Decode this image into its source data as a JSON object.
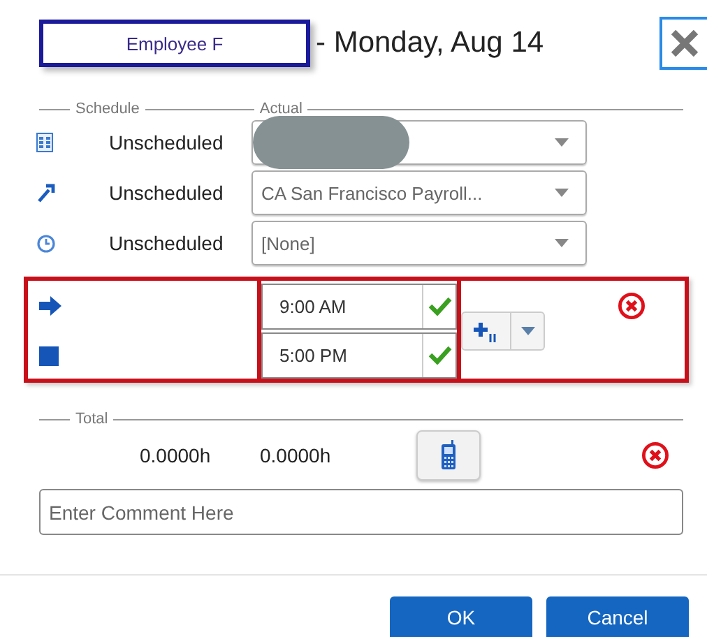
{
  "dialog": {
    "employee": "Employee F",
    "title": "- Monday, Aug 14"
  },
  "legend": {
    "schedule": "Schedule",
    "actual": "Actual"
  },
  "fields": [
    {
      "kind": "department",
      "schedule": "Unscheduled",
      "redacted": true
    },
    {
      "kind": "job",
      "schedule": "Unscheduled",
      "value": "CA San Francisco Payroll...",
      "redacted": false
    },
    {
      "kind": "clock",
      "schedule": "Unscheduled",
      "value": "[None]",
      "redacted": false
    }
  ],
  "punches": [
    {
      "kind": "in",
      "time": "9:00 AM",
      "valid": true
    },
    {
      "kind": "out",
      "time": "5:00 PM",
      "valid": true
    }
  ],
  "total": {
    "label": "Total",
    "schedule": "0.0000h",
    "actual": "0.0000h"
  },
  "comment": {
    "placeholder": "Enter Comment Here"
  },
  "buttons": [
    "OK",
    "Cancel"
  ]
}
